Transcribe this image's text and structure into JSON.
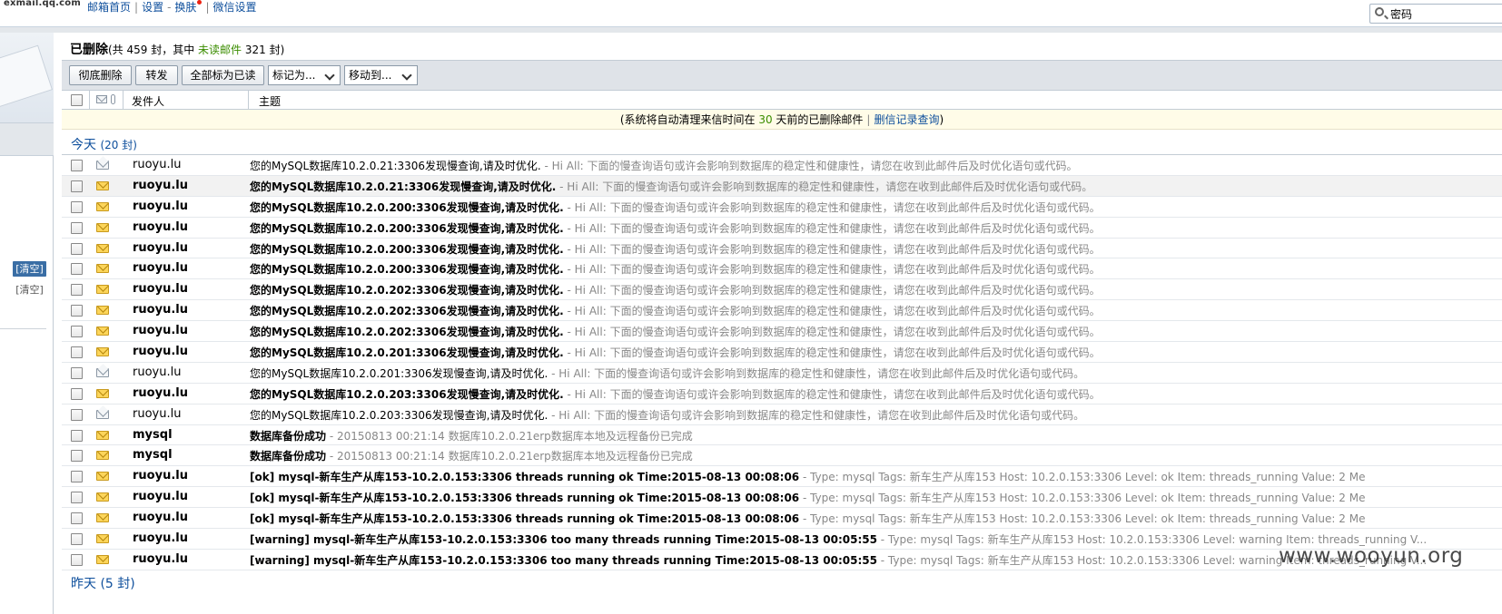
{
  "topbar": {
    "logo": "exmail.qq.com",
    "links": [
      "邮箱首页",
      "设置",
      "换肤",
      "微信设置"
    ],
    "separators": [
      "|",
      "-",
      "|"
    ],
    "search_value": "密码"
  },
  "sidebar": {
    "clear_active": "[清空]",
    "clear_inactive": "[清空]"
  },
  "folder": {
    "name": "已删除",
    "stats_prefix": "(共 459 封，其中 ",
    "unread_label": "未读邮件",
    "stats_suffix": " 321 封)"
  },
  "toolbar": {
    "delete_forever": "彻底删除",
    "forward": "转发",
    "mark_all_read": "全部标为已读",
    "mark_as": "标记为...",
    "move_to": "移动到..."
  },
  "columns": {
    "sender": "发件人",
    "subject": "主题"
  },
  "notice": {
    "prefix": "(系统将自动清理来信时间在 ",
    "days": "30",
    "suffix": " 天前的已删除邮件",
    "bar": "|",
    "link": "删信记录查询",
    "close": ")"
  },
  "groups": {
    "today": {
      "label": "今天",
      "count": "(20 封)"
    },
    "yesterday": {
      "label": "昨天",
      "count": "(5 封)"
    }
  },
  "emails": [
    {
      "sender": "ruoyu.lu",
      "subject": "您的MySQL数据库10.2.0.21:3306发现慢查询,请及时优化.",
      "snippet": " - Hi All: 下面的慢查询语句或许会影响到数据库的稳定性和健康性，请您在收到此邮件后及时优化语句或代码。",
      "unread": false,
      "highlight": false
    },
    {
      "sender": "ruoyu.lu",
      "subject": "您的MySQL数据库10.2.0.21:3306发现慢查询,请及时优化.",
      "snippet": " - Hi All: 下面的慢查询语句或许会影响到数据库的稳定性和健康性，请您在收到此邮件后及时优化语句或代码。",
      "unread": true,
      "highlight": true
    },
    {
      "sender": "ruoyu.lu",
      "subject": "您的MySQL数据库10.2.0.200:3306发现慢查询,请及时优化.",
      "snippet": " - Hi All: 下面的慢查询语句或许会影响到数据库的稳定性和健康性，请您在收到此邮件后及时优化语句或代码。",
      "unread": true,
      "highlight": false
    },
    {
      "sender": "ruoyu.lu",
      "subject": "您的MySQL数据库10.2.0.200:3306发现慢查询,请及时优化.",
      "snippet": " - Hi All: 下面的慢查询语句或许会影响到数据库的稳定性和健康性，请您在收到此邮件后及时优化语句或代码。",
      "unread": true,
      "highlight": false
    },
    {
      "sender": "ruoyu.lu",
      "subject": "您的MySQL数据库10.2.0.200:3306发现慢查询,请及时优化.",
      "snippet": " - Hi All: 下面的慢查询语句或许会影响到数据库的稳定性和健康性，请您在收到此邮件后及时优化语句或代码。",
      "unread": true,
      "highlight": false
    },
    {
      "sender": "ruoyu.lu",
      "subject": "您的MySQL数据库10.2.0.200:3306发现慢查询,请及时优化.",
      "snippet": " - Hi All: 下面的慢查询语句或许会影响到数据库的稳定性和健康性，请您在收到此邮件后及时优化语句或代码。",
      "unread": true,
      "highlight": false
    },
    {
      "sender": "ruoyu.lu",
      "subject": "您的MySQL数据库10.2.0.202:3306发现慢查询,请及时优化.",
      "snippet": " - Hi All: 下面的慢查询语句或许会影响到数据库的稳定性和健康性，请您在收到此邮件后及时优化语句或代码。",
      "unread": true,
      "highlight": false
    },
    {
      "sender": "ruoyu.lu",
      "subject": "您的MySQL数据库10.2.0.202:3306发现慢查询,请及时优化.",
      "snippet": " - Hi All: 下面的慢查询语句或许会影响到数据库的稳定性和健康性，请您在收到此邮件后及时优化语句或代码。",
      "unread": true,
      "highlight": false
    },
    {
      "sender": "ruoyu.lu",
      "subject": "您的MySQL数据库10.2.0.202:3306发现慢查询,请及时优化.",
      "snippet": " - Hi All: 下面的慢查询语句或许会影响到数据库的稳定性和健康性，请您在收到此邮件后及时优化语句或代码。",
      "unread": true,
      "highlight": false
    },
    {
      "sender": "ruoyu.lu",
      "subject": "您的MySQL数据库10.2.0.201:3306发现慢查询,请及时优化.",
      "snippet": " - Hi All: 下面的慢查询语句或许会影响到数据库的稳定性和健康性，请您在收到此邮件后及时优化语句或代码。",
      "unread": true,
      "highlight": false
    },
    {
      "sender": "ruoyu.lu",
      "subject": "您的MySQL数据库10.2.0.201:3306发现慢查询,请及时优化.",
      "snippet": " - Hi All: 下面的慢查询语句或许会影响到数据库的稳定性和健康性，请您在收到此邮件后及时优化语句或代码。",
      "unread": false,
      "highlight": false
    },
    {
      "sender": "ruoyu.lu",
      "subject": "您的MySQL数据库10.2.0.203:3306发现慢查询,请及时优化.",
      "snippet": " - Hi All: 下面的慢查询语句或许会影响到数据库的稳定性和健康性，请您在收到此邮件后及时优化语句或代码。",
      "unread": true,
      "highlight": false
    },
    {
      "sender": "ruoyu.lu",
      "subject": "您的MySQL数据库10.2.0.203:3306发现慢查询,请及时优化.",
      "snippet": " - Hi All: 下面的慢查询语句或许会影响到数据库的稳定性和健康性，请您在收到此邮件后及时优化语句或代码。",
      "unread": false,
      "highlight": false
    },
    {
      "sender": "mysql",
      "subject": "数据库备份成功",
      "snippet": " - 20150813 00:21:14 数据库10.2.0.21erp数据库本地及远程备份已完成",
      "unread": true,
      "highlight": false
    },
    {
      "sender": "mysql",
      "subject": "数据库备份成功",
      "snippet": " - 20150813 00:21:14 数据库10.2.0.21erp数据库本地及远程备份已完成",
      "unread": true,
      "highlight": false
    },
    {
      "sender": "ruoyu.lu",
      "subject": "[ok] mysql-新车生产从库153-10.2.0.153:3306 threads running ok Time:2015-08-13 00:08:06",
      "snippet": " - Type: mysql Tags: 新车生产从库153 Host: 10.2.0.153:3306 Level: ok Item: threads_running Value: 2 Me",
      "unread": true,
      "highlight": false
    },
    {
      "sender": "ruoyu.lu",
      "subject": "[ok] mysql-新车生产从库153-10.2.0.153:3306 threads running ok Time:2015-08-13 00:08:06",
      "snippet": " - Type: mysql Tags: 新车生产从库153 Host: 10.2.0.153:3306 Level: ok Item: threads_running Value: 2 Me",
      "unread": true,
      "highlight": false
    },
    {
      "sender": "ruoyu.lu",
      "subject": "[ok] mysql-新车生产从库153-10.2.0.153:3306 threads running ok Time:2015-08-13 00:08:06",
      "snippet": " - Type: mysql Tags: 新车生产从库153 Host: 10.2.0.153:3306 Level: ok Item: threads_running Value: 2 Me",
      "unread": true,
      "highlight": false
    },
    {
      "sender": "ruoyu.lu",
      "subject": "[warning] mysql-新车生产从库153-10.2.0.153:3306 too many threads running Time:2015-08-13 00:05:55",
      "snippet": " - Type: mysql Tags: 新车生产从库153 Host: 10.2.0.153:3306 Level: warning Item: threads_running V...",
      "unread": true,
      "highlight": false
    },
    {
      "sender": "ruoyu.lu",
      "subject": "[warning] mysql-新车生产从库153-10.2.0.153:3306 too many threads running Time:2015-08-13 00:05:55",
      "snippet": " - Type: mysql Tags: 新车生产从库153 Host: 10.2.0.153:3306 Level: warning Item: threads_running V...",
      "unread": true,
      "highlight": false
    }
  ],
  "watermark": "www.wooyun.org",
  "colors": {
    "link": "#0e4f9c",
    "unread_count": "#3b8d00",
    "snippet": "#888888",
    "toolbar_bg": "#dfe3e8",
    "notice_bg": "#fffce8"
  }
}
